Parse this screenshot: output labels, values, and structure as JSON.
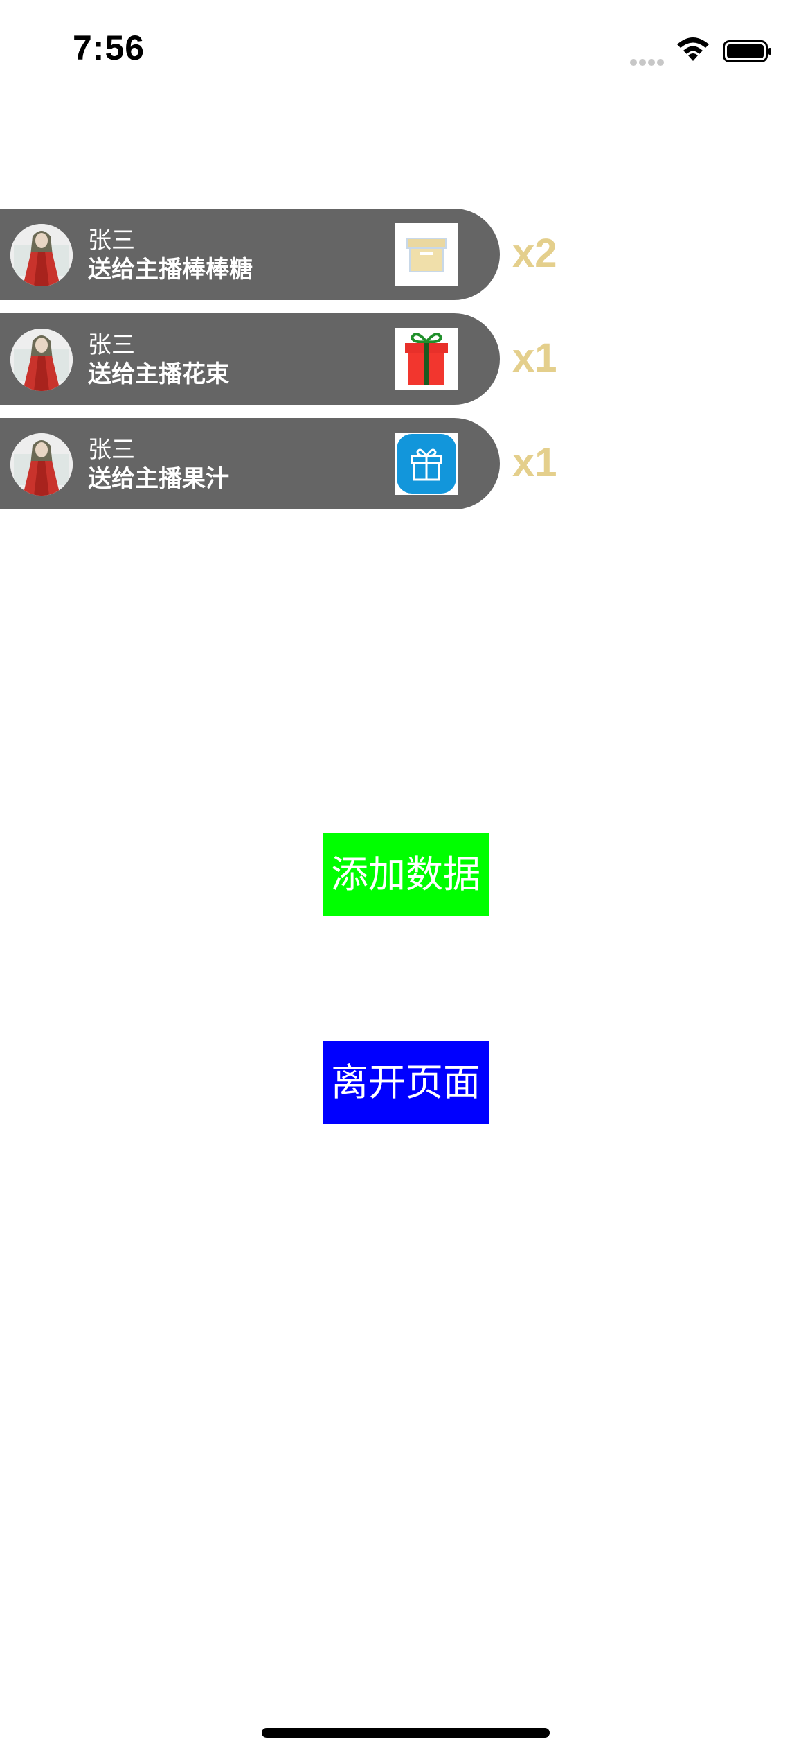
{
  "status_bar": {
    "time": "7:56"
  },
  "gift_list": [
    {
      "sender": "张三",
      "description": "送给主播棒棒糖",
      "count": "x2",
      "gift_icon": "box-icon"
    },
    {
      "sender": "张三",
      "description": "送给主播花束",
      "count": "x1",
      "gift_icon": "gift-box-icon"
    },
    {
      "sender": "张三",
      "description": "送给主播果汁",
      "count": "x1",
      "gift_icon": "gift-app-icon"
    }
  ],
  "buttons": {
    "add_data": "添加数据",
    "leave_page": "离开页面"
  },
  "colors": {
    "banner_bg": "#656565",
    "count_text": "#e4cf8c",
    "add_button": "#00ff00",
    "leave_button": "#0000ff"
  }
}
